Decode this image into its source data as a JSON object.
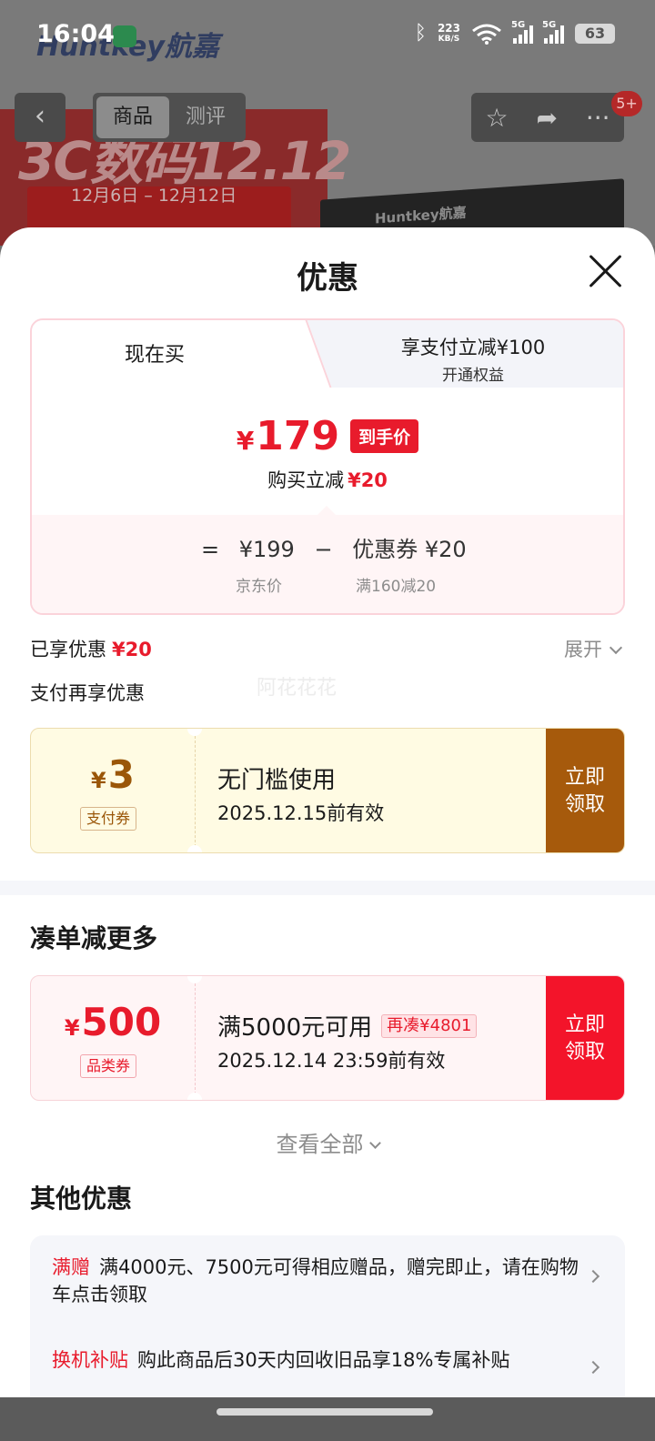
{
  "status_bar": {
    "time": "16:04",
    "net_speed_value": "223",
    "net_speed_unit": "KB/S",
    "signal_1": "5G",
    "signal_2": "5G",
    "battery": "63",
    "icons": [
      "bluetooth-icon",
      "wifi-icon",
      "signal-icon",
      "battery-icon"
    ]
  },
  "background_page": {
    "brand": "Huntkey航嘉",
    "tabs": [
      "商品",
      "测评"
    ],
    "active_tab": "商品",
    "banner_title": "3C数码12.12",
    "banner_date": "12月6日 – 12月12日",
    "product_text": "Huntkey航嘉",
    "badge": "5+"
  },
  "sheet": {
    "title": "优惠",
    "tabs": {
      "now": "现在买",
      "alt_line1": "享支付立减¥100",
      "alt_line2": "开通权益"
    },
    "price": {
      "symbol": "¥",
      "value": "179",
      "tag": "到手价",
      "sub_label": "购买立减",
      "sub_value": "¥20",
      "formula_eq": "=",
      "jd_price": "¥199",
      "minus": "−",
      "coupon_label": "优惠券 ¥20",
      "jd_price_label": "京东价",
      "coupon_rule": "满160减20"
    },
    "enjoyed_label": "已享优惠",
    "enjoyed_value": "¥20",
    "expand_label": "展开",
    "pay_more_label": "支付再享优惠",
    "watermark": "阿花花花",
    "pay_coupon": {
      "symbol": "¥",
      "amount": "3",
      "type": "支付券",
      "name": "无门槛使用",
      "date": "2025.12.15前有效",
      "button": "立即领取"
    },
    "section1_title": "凑单减更多",
    "cat_coupon": {
      "symbol": "¥",
      "amount": "500",
      "type": "品类券",
      "name": "满5000元可用",
      "tag": "再凑¥4801",
      "date": "2025.12.14 23:59前有效",
      "button": "立即领取"
    },
    "view_all": "查看全部",
    "section2_title": "其他优惠",
    "other": [
      {
        "label": "满赠",
        "text": "满4000元、7500元可得相应赠品，赠完即止，请在购物车点击领取"
      },
      {
        "label": "换机补贴",
        "text": "购此商品后30天内回收旧品享18%专属补贴"
      }
    ]
  },
  "colors": {
    "accent_red": "#e81b2c",
    "pay_coupon_brown": "#a65a0c",
    "coupon_red": "#f3142a"
  }
}
